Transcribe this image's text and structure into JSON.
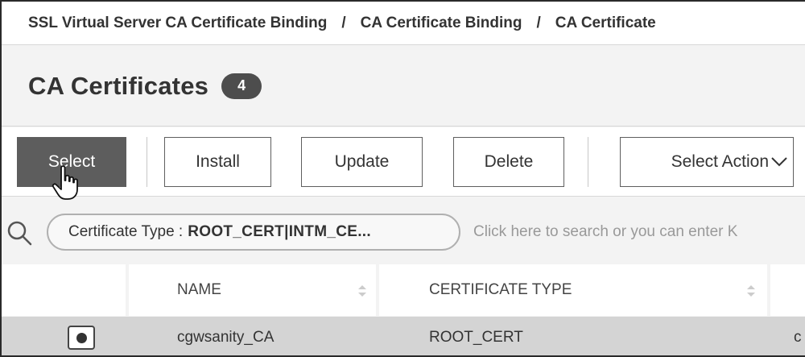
{
  "breadcrumb": {
    "items": [
      "SSL Virtual Server CA Certificate Binding",
      "CA Certificate Binding",
      "CA Certificate"
    ],
    "separator": "/"
  },
  "header": {
    "title": "CA Certificates",
    "count": "4"
  },
  "toolbar": {
    "select_label": "Select",
    "install_label": "Install",
    "update_label": "Update",
    "delete_label": "Delete",
    "select_action_label": "Select Action"
  },
  "search": {
    "filter_key": "Certificate Type :",
    "filter_value": "ROOT_CERT|INTM_CE...",
    "placeholder": "Click here to search or you can enter K"
  },
  "table": {
    "columns": [
      "NAME",
      "CERTIFICATE TYPE"
    ],
    "rows": [
      {
        "name": "cgwsanity_CA",
        "certificate_type": "ROOT_CERT",
        "extra": "c",
        "selected": true
      }
    ]
  },
  "colors": {
    "primary_button": "#5d5d5d",
    "badge": "#4d4d4d",
    "selected_row": "#d4d4d4"
  },
  "icons": {
    "search": "search-icon",
    "sort": "sort-icon",
    "chevron": "chevron-down-icon",
    "cursor": "hand-pointer-icon"
  }
}
